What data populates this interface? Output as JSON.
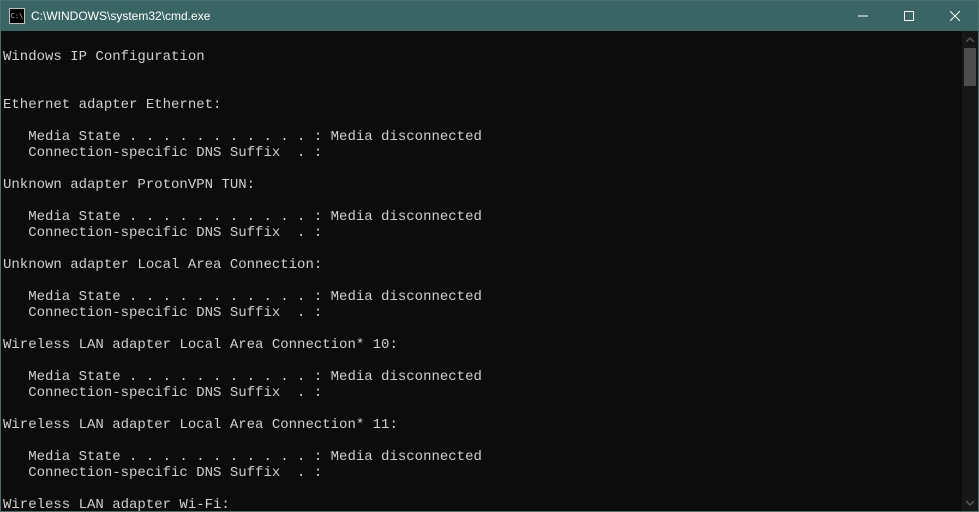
{
  "window": {
    "title": "C:\\WINDOWS\\system32\\cmd.exe",
    "icon_label": "cmd-icon"
  },
  "output": {
    "header": "Windows IP Configuration",
    "label_media_state": "   Media State . . . . . . . . . . . : ",
    "label_dns_suffix": "   Connection-specific DNS Suffix  . :",
    "sections": [
      {
        "title": "Ethernet adapter Ethernet:",
        "media_state": "Media disconnected",
        "dns_suffix": ""
      },
      {
        "title": "Unknown adapter ProtonVPN TUN:",
        "media_state": "Media disconnected",
        "dns_suffix": ""
      },
      {
        "title": "Unknown adapter Local Area Connection:",
        "media_state": "Media disconnected",
        "dns_suffix": ""
      },
      {
        "title": "Wireless LAN adapter Local Area Connection* 10:",
        "media_state": "Media disconnected",
        "dns_suffix": ""
      },
      {
        "title": "Wireless LAN adapter Local Area Connection* 11:",
        "media_state": "Media disconnected",
        "dns_suffix": ""
      },
      {
        "title": "Wireless LAN adapter Wi-Fi:",
        "media_state": null,
        "dns_suffix": null
      }
    ]
  }
}
